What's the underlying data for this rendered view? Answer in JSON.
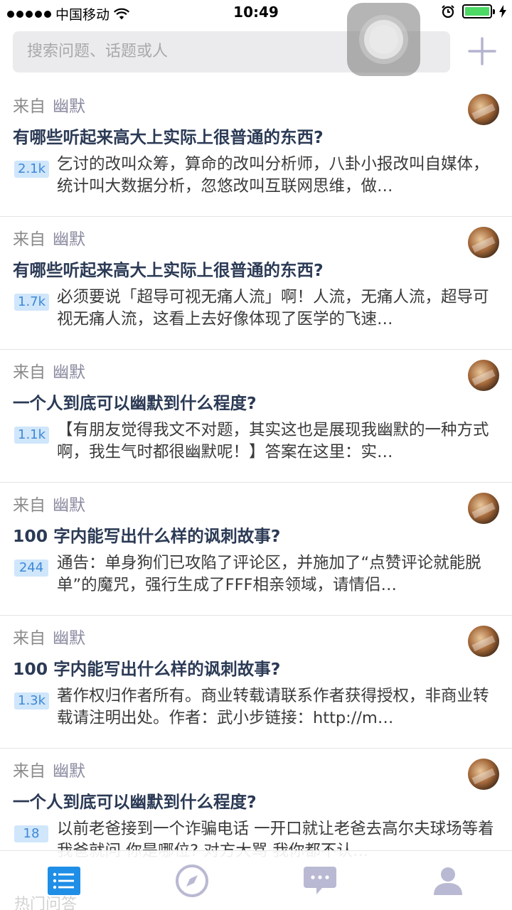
{
  "status_bar": {
    "carrier": "中国移动",
    "time": "10:49"
  },
  "search": {
    "placeholder": "搜索问题、话题或人"
  },
  "feed": [
    {
      "source_prefix": "来自",
      "topic": "幽默",
      "title": "有哪些听起来高大上实际上很普通的东西?",
      "votes": "2.1k",
      "excerpt": "乞讨的改叫众筹，算命的改叫分析师，八卦小报改叫自媒体，统计叫大数据分析，忽悠改叫互联网思维，做…"
    },
    {
      "source_prefix": "来自",
      "topic": "幽默",
      "title": "有哪些听起来高大上实际上很普通的东西?",
      "votes": "1.7k",
      "excerpt": "必须要说「超导可视无痛人流」啊！人流，无痛人流，超导可视无痛人流，这看上去好像体现了医学的飞速…"
    },
    {
      "source_prefix": "来自",
      "topic": "幽默",
      "title": "一个人到底可以幽默到什么程度?",
      "votes": "1.1k",
      "excerpt": "【有朋友觉得我文不对题，其实这也是展现我幽默的一种方式啊，我生气时都很幽默呢！】答案在这里：实…"
    },
    {
      "source_prefix": "来自",
      "topic": "幽默",
      "title": "100 字内能写出什么样的讽刺故事?",
      "votes": "244",
      "excerpt": "通告：单身狗们已攻陷了评论区，并施加了“点赞评论就能脱单”的魔咒，强行生成了FFF相亲领域，请情侣…"
    },
    {
      "source_prefix": "来自",
      "topic": "幽默",
      "title": "100 字内能写出什么样的讽刺故事?",
      "votes": "1.3k",
      "excerpt": "著作权归作者所有。商业转载请联系作者获得授权，非商业转载请注明出处。作者：武小步链接：http://m…"
    },
    {
      "source_prefix": "来自",
      "topic": "幽默",
      "title": "一个人到底可以幽默到什么程度?",
      "votes": "18",
      "excerpt": "以前老爸接到一个诈骗电话 一开口就让老爸去高尔夫球场等着我爸就问 你是哪位? 对方大骂 我你都不认…"
    }
  ],
  "peek_label": "热门问答",
  "colors": {
    "accent": "#1f8ee6",
    "tab_inactive": "#b9b9d3",
    "vote_bg": "#cfe6fb",
    "vote_text": "#3f88d6"
  },
  "tabs": [
    {
      "icon": "list-icon",
      "active": true
    },
    {
      "icon": "compass-icon",
      "active": false
    },
    {
      "icon": "chat-icon",
      "active": false
    },
    {
      "icon": "person-icon",
      "active": false
    }
  ]
}
